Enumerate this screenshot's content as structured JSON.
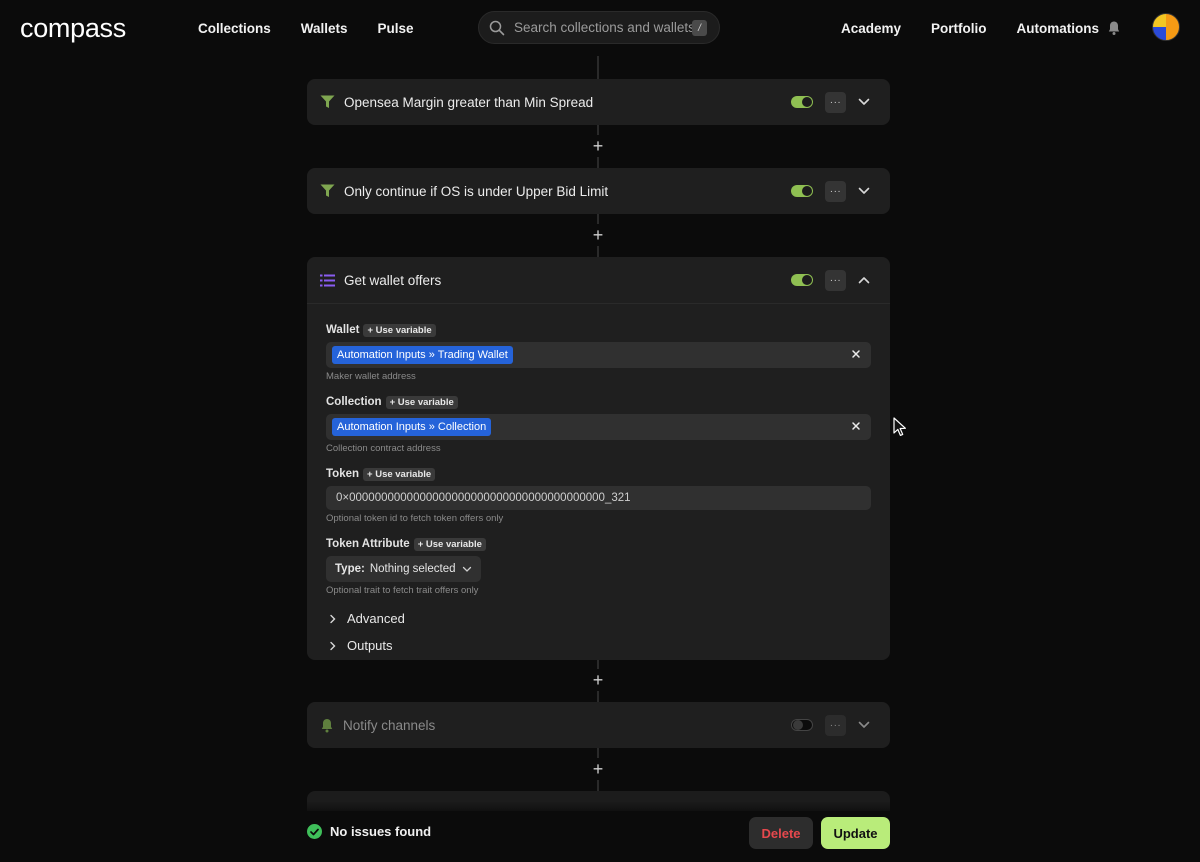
{
  "nav": {
    "logo": "compass",
    "left_items": [
      "Collections",
      "Wallets",
      "Pulse"
    ],
    "search_placeholder": "Search collections and wallets",
    "search_shortcut": "/",
    "right_items": [
      "Academy",
      "Portfolio",
      "Automations"
    ]
  },
  "steps": [
    {
      "title": "Opensea Margin greater than Min Spread",
      "icon": "filter-icon",
      "enabled": true,
      "expanded": false
    },
    {
      "title": "Only continue if OS is under Upper Bid Limit",
      "icon": "filter-icon",
      "enabled": true,
      "expanded": false
    },
    {
      "title": "Get wallet offers",
      "icon": "list-icon",
      "enabled": true,
      "expanded": true
    },
    {
      "title": "Notify channels",
      "icon": "bell-icon",
      "enabled": false,
      "expanded": false
    }
  ],
  "form": {
    "use_variable_label": "Use variable",
    "wallet": {
      "label": "Wallet",
      "chip": "Automation Inputs » Trading Wallet",
      "hint": "Maker wallet address"
    },
    "collection": {
      "label": "Collection",
      "chip": "Automation Inputs » Collection",
      "hint": "Collection contract address"
    },
    "token": {
      "label": "Token",
      "value": "0×0000000000000000000000000000000000000000_321",
      "hint": "Optional token id to fetch token offers only"
    },
    "token_attribute": {
      "label": "Token Attribute",
      "select_label": "Type:",
      "select_value": "Nothing selected",
      "hint": "Optional trait to fetch trait offers only"
    },
    "advanced_label": "Advanced",
    "outputs_label": "Outputs"
  },
  "footer": {
    "status": "No issues found",
    "delete_label": "Delete",
    "update_label": "Update"
  },
  "colors": {
    "toggle_on": "#8fbf52",
    "chip_bg": "#2563d9",
    "update_bg": "#b9ec7a",
    "delete_text": "#e5484d",
    "status_ok": "#3fbf5a",
    "filter_icon": "#7fa650",
    "list_icon": "#8a5cf0"
  }
}
